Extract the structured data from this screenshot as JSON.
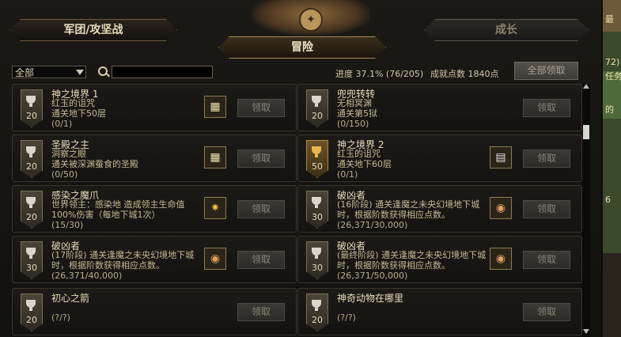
{
  "tabs": {
    "left": "军团/攻坚战",
    "center": "冒险",
    "right": "成长"
  },
  "filter": {
    "selected": "全部"
  },
  "search": {
    "placeholder": ""
  },
  "stats": {
    "progress": "进度 37.1% (76/205)",
    "points": "成就点数 1840点"
  },
  "claim_all_label": "全部领取",
  "side_texts": [
    "最",
    "72)",
    "任务",
    "的",
    "6"
  ],
  "achievements": [
    {
      "title": "神之境界 1",
      "desc": "红玉的诅咒\n通关地下50层",
      "count": "(0/1)",
      "points": "20",
      "reward": "chest-icon",
      "claim": "领取",
      "gold": false
    },
    {
      "title": "兜兜转转",
      "desc": "无相冥渊\n通关第5狱",
      "count": "(0/150)",
      "points": "20",
      "reward": "",
      "claim": "领取",
      "gold": false
    },
    {
      "title": "圣殿之主",
      "desc": "洞察之眼\n通关被深渊蚕食的圣殿",
      "count": "(0/50)",
      "points": "20",
      "reward": "chest-icon",
      "claim": "领取",
      "gold": false
    },
    {
      "title": "神之境界 2",
      "desc": "红玉的诅咒\n通关地下60层",
      "count": "(0/1)",
      "points": "50",
      "reward": "scroll-icon",
      "claim": "领取",
      "gold": true
    },
    {
      "title": "感染之魔爪",
      "desc": "世界领主：感染地      造成领主生命值100%伤害（每地下城1次）",
      "count": "(15/30)",
      "points": "20",
      "reward": "gold-icon",
      "claim": "领取",
      "gold": false
    },
    {
      "title": "破凶者",
      "desc": "(16阶段) 通关逢魔之未央幻境地下城时，根据阶数获得相应点数。",
      "count": "(26,371/30,000)",
      "points": "30",
      "reward": "emblem-icon",
      "claim": "领取",
      "gold": false
    },
    {
      "title": "破凶者",
      "desc": "(17阶段) 通关逢魔之未央幻境地下城时，根据阶数获得相应点数。",
      "count": "(26,371/40,000)",
      "points": "30",
      "reward": "emblem-icon",
      "claim": "领取",
      "gold": false
    },
    {
      "title": "破凶者",
      "desc": "(最终阶段) 通关逢魔之未央幻境地下城时，根据阶数获得相应点数。",
      "count": "(26,371/50,000)",
      "points": "30",
      "reward": "emblem-icon",
      "claim": "领取",
      "gold": false
    },
    {
      "title": "初心之箭",
      "desc": "",
      "count": "(?/?)",
      "points": "20",
      "reward": "",
      "claim": "领取",
      "gold": false
    },
    {
      "title": "神奇动物在哪里",
      "desc": "",
      "count": "(?/?)",
      "points": "20",
      "reward": "",
      "claim": "领取",
      "gold": false
    }
  ]
}
